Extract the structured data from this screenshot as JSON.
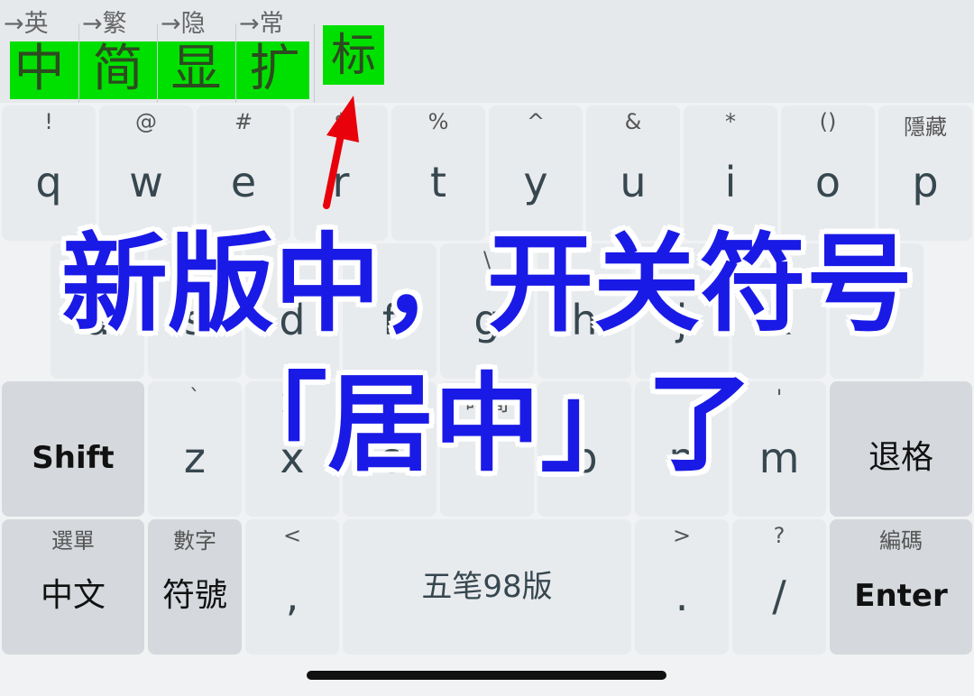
{
  "toolbar": {
    "groups": [
      {
        "hint": "→英",
        "char": "中"
      },
      {
        "hint": "→繁",
        "char": "简"
      },
      {
        "hint": "→隐",
        "char": "显"
      },
      {
        "hint": "→常",
        "char": "扩"
      }
    ],
    "mark_char": "标"
  },
  "rows": {
    "row1": [
      {
        "sub": "!",
        "main": "q"
      },
      {
        "sub": "@",
        "main": "w"
      },
      {
        "sub": "#",
        "main": "e"
      },
      {
        "sub": "$",
        "main": "r"
      },
      {
        "sub": "%",
        "main": "t"
      },
      {
        "sub": "^",
        "main": "y"
      },
      {
        "sub": "&",
        "main": "u"
      },
      {
        "sub": "*",
        "main": "i"
      },
      {
        "sub": "()",
        "main": "o"
      },
      {
        "sub": "隱藏",
        "main": "p"
      }
    ],
    "row2": [
      {
        "sub": "",
        "main": "a"
      },
      {
        "sub": "",
        "main": "s"
      },
      {
        "sub": "",
        "main": "d"
      },
      {
        "sub": "",
        "main": "f"
      },
      {
        "sub": "\\",
        "main": "g"
      },
      {
        "sub": "",
        "main": "h"
      },
      {
        "sub": "",
        "main": "j"
      },
      {
        "sub": "",
        "main": "k"
      },
      {
        "sub": "",
        "main": "l"
      }
    ],
    "row3": [
      {
        "sub": "",
        "main": "Shift"
      },
      {
        "sub": "`",
        "main": "z"
      },
      {
        "sub": "剪",
        "main": "x"
      },
      {
        "sub": "",
        "main": "c"
      },
      {
        "sub": "時間",
        "main": "v"
      },
      {
        "sub": "",
        "main": "b"
      },
      {
        "sub": "",
        "main": "n"
      },
      {
        "sub": "'",
        "main": "m"
      },
      {
        "sub": "",
        "main": "退格"
      }
    ],
    "row4": [
      {
        "sub": "選單",
        "main": "中文"
      },
      {
        "sub": "數字",
        "main": "符號"
      },
      {
        "sub": "<",
        "main": ","
      },
      {
        "sub": "",
        "main": "五笔98版"
      },
      {
        "sub": ">",
        "main": "."
      },
      {
        "sub": "?",
        "main": "/"
      },
      {
        "sub": "編碼",
        "main": "Enter"
      }
    ]
  },
  "annotation": {
    "line1": "新版中，开关符号",
    "line2": "「居中」了",
    "arrow_color": "#e8000a"
  }
}
